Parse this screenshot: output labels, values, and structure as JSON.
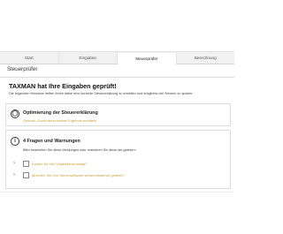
{
  "tabs": [
    {
      "label": "Start"
    },
    {
      "label": "Eingaben"
    },
    {
      "label": "Steuerprüfer"
    },
    {
      "label": "Berechnung"
    }
  ],
  "active_tab_index": 2,
  "section": {
    "title": "Steuerprüfer"
  },
  "main": {
    "headline": "TAXMAN hat Ihre Eingaben geprüft!",
    "intro": "Die folgenden Hinweise helfen Ihnen dabei eine korrekte Steuererklärung zu erstellen und möglichst viel Steuern zu sparen."
  },
  "optimization": {
    "icon": "lightbulb-icon",
    "title": "Optimierung der Steuererklärung",
    "link": "Optimal: Zuviel berechnetes Ergebnis ermitteln"
  },
  "warnings": {
    "icon": "info-icon",
    "title": "4 Fragen und Warnungen",
    "subtitle": "Bitte bearbeiten Sie diese Meldungen oder markieren Sie diese als gelesen:",
    "items": [
      {
        "label": "Kosten für den Vorjahresveranlagt?"
      },
      {
        "label": "Möchten Sie Ihre Steuersoftware steuerminderndt geltend?"
      }
    ]
  },
  "colors": {
    "link": "#c9a23a",
    "border": "#dcdcdc",
    "tab_bg": "#f1f1f1"
  }
}
